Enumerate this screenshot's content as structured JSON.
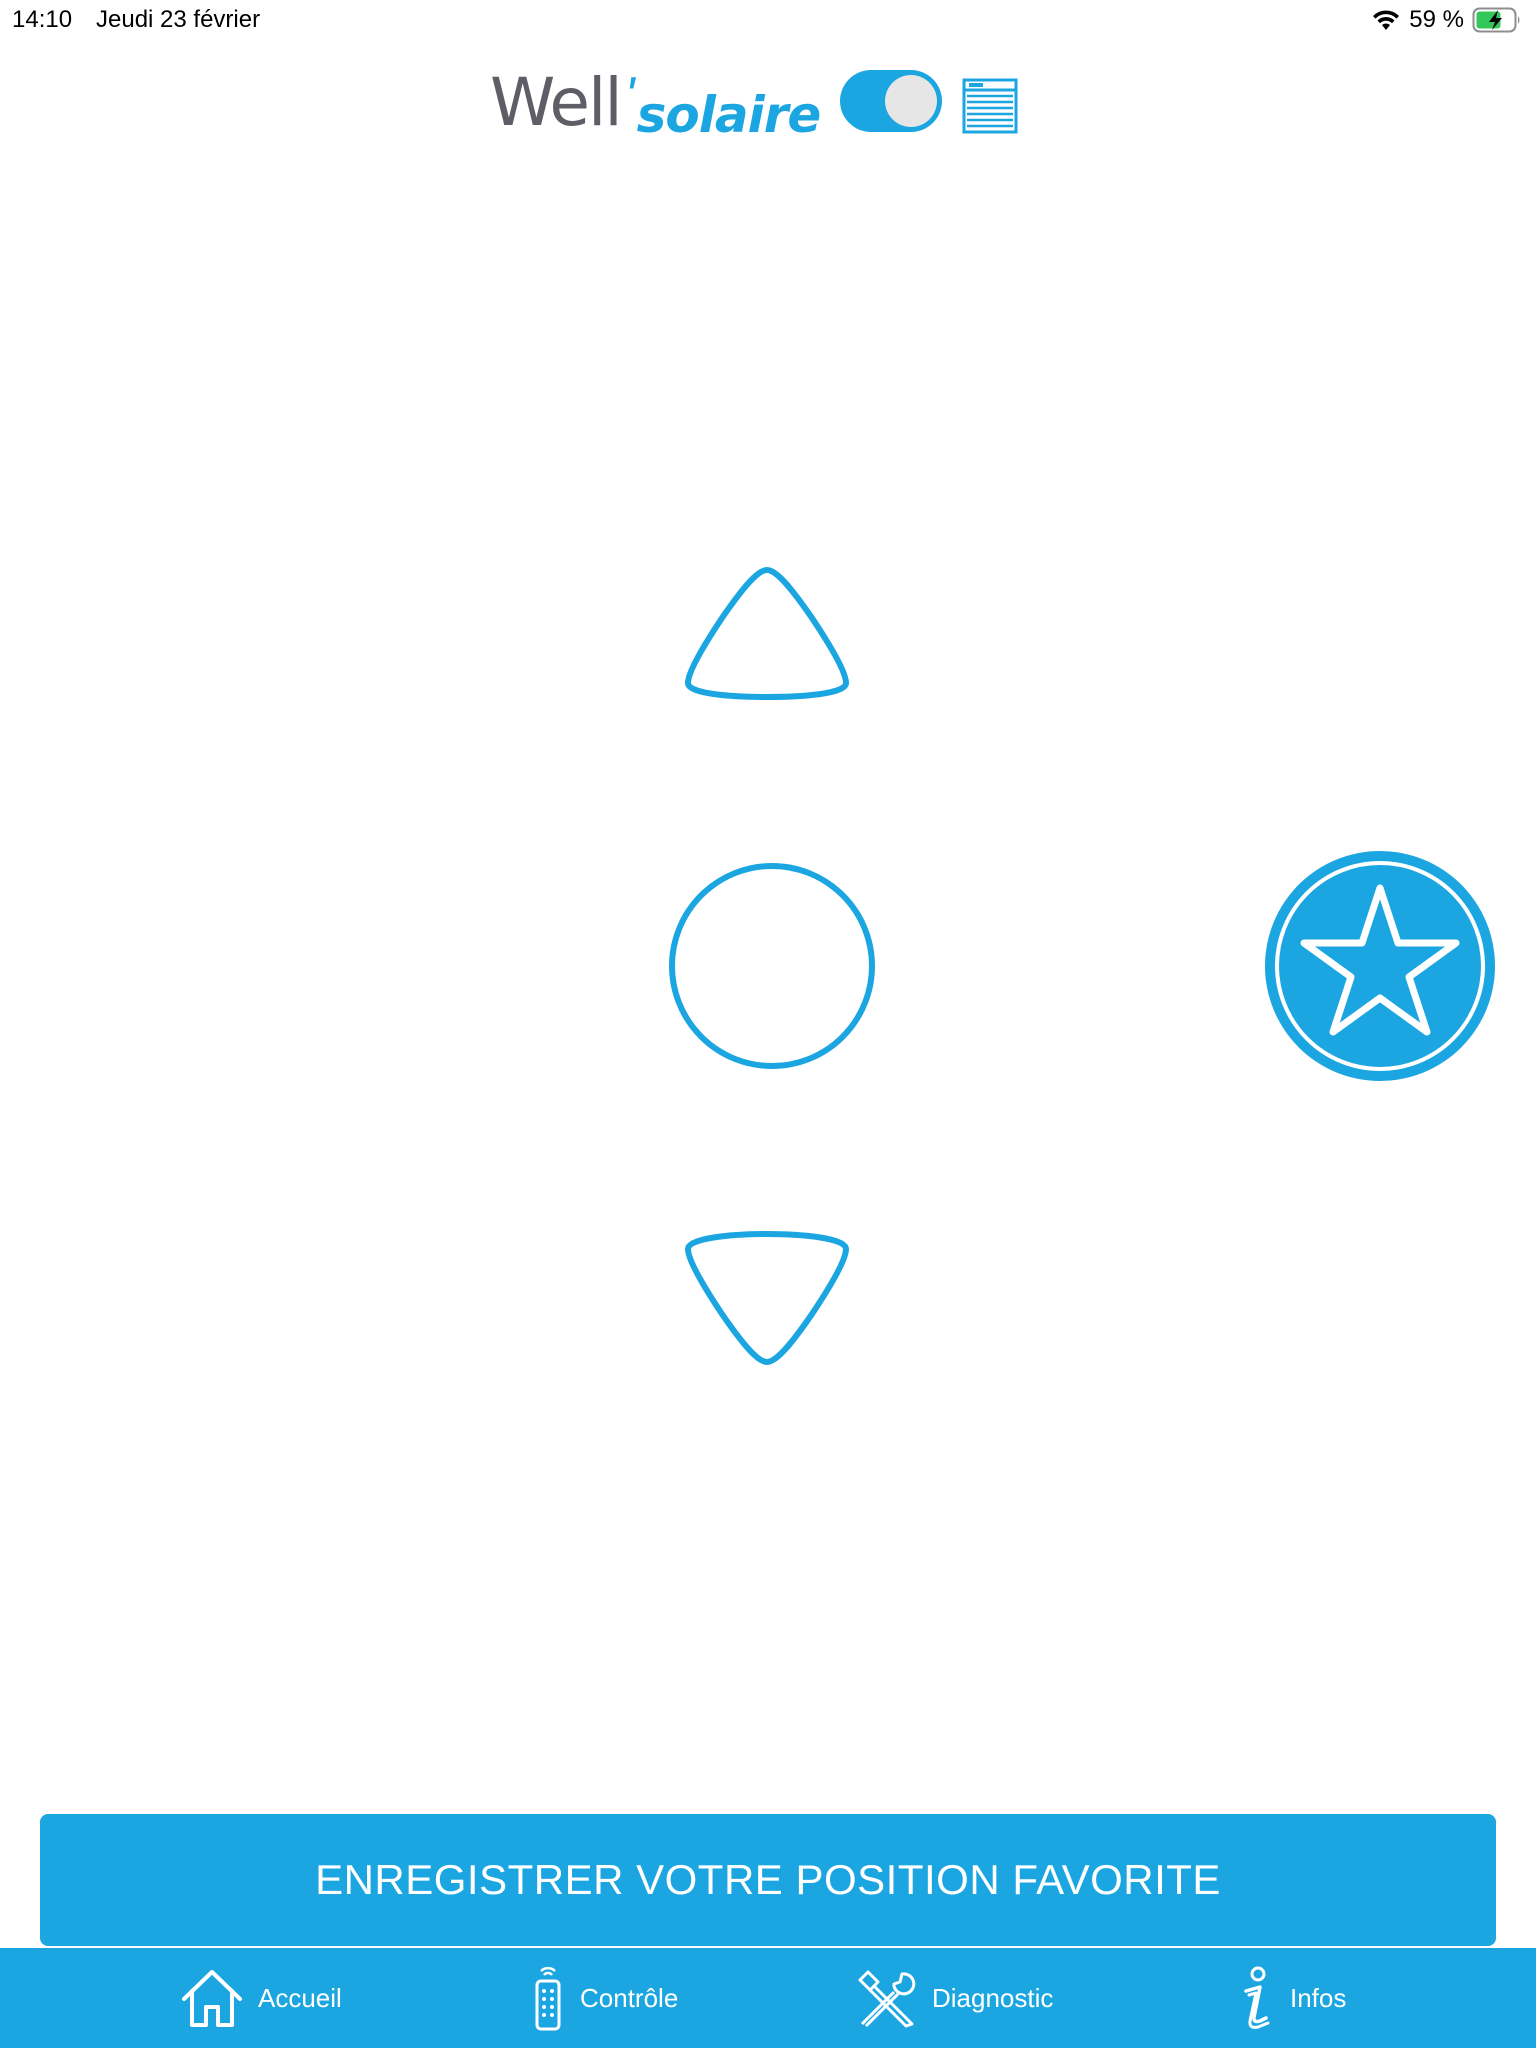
{
  "status_bar": {
    "time": "14:10",
    "date": "Jeudi 23 février",
    "battery": "59 %",
    "icons": [
      "wifi-icon",
      "battery-charging-icon"
    ]
  },
  "header": {
    "logo_well": "Well",
    "logo_apostrophe": "'",
    "logo_solaire": "solaire",
    "toggle_on": true,
    "device_icon": "window-blind-icon"
  },
  "controls": {
    "up_icon": "triangle-up-icon",
    "stop_icon": "circle-stop-icon",
    "down_icon": "triangle-down-icon",
    "favorite_icon": "star-icon"
  },
  "save_button": {
    "label": "ENREGISTRER VOTRE POSITION FAVORITE"
  },
  "tab_bar": {
    "items": [
      {
        "label": "Accueil",
        "icon": "home-icon"
      },
      {
        "label": "Contrôle",
        "icon": "remote-icon"
      },
      {
        "label": "Diagnostic",
        "icon": "tools-icon"
      },
      {
        "label": "Infos",
        "icon": "info-icon"
      }
    ]
  },
  "colors": {
    "accent": "#1ba6e2",
    "logo_gray": "#5e5e66",
    "background": "#ffffff"
  }
}
